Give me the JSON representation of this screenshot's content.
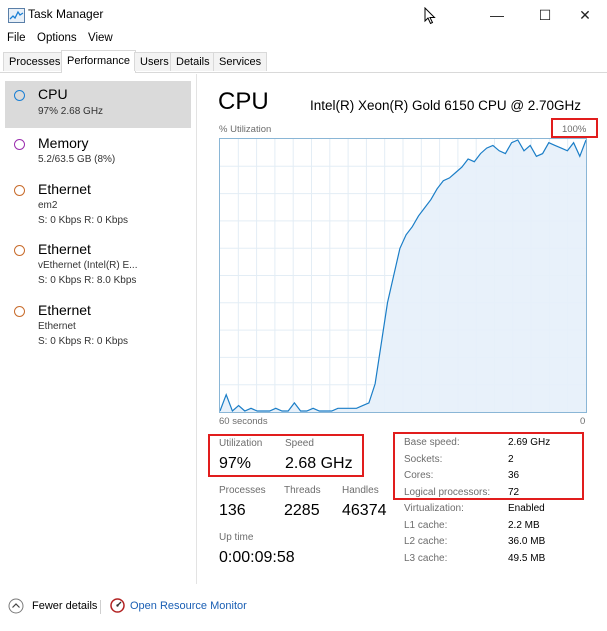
{
  "window": {
    "title": "Task Manager",
    "minimize": "—",
    "maximize": "☐",
    "close": "✕"
  },
  "menu": [
    "File",
    "Options",
    "View"
  ],
  "tabs": [
    "Processes",
    "Performance",
    "Users",
    "Details",
    "Services"
  ],
  "sidebar": [
    {
      "title": "CPU",
      "line1": "97% 2.68 GHz",
      "line2": "",
      "color": "#1a7fd4"
    },
    {
      "title": "Memory",
      "line1": "5.2/63.5 GB (8%)",
      "line2": "",
      "color": "#9b2fae"
    },
    {
      "title": "Ethernet",
      "line1": "em2",
      "line2": "S: 0 Kbps R: 0 Kbps",
      "color": "#c86c2c"
    },
    {
      "title": "Ethernet",
      "line1": "vEthernet (Intel(R) E...",
      "line2": "S: 0 Kbps R: 8.0 Kbps",
      "color": "#c86c2c"
    },
    {
      "title": "Ethernet",
      "line1": "Ethernet",
      "line2": "S: 0 Kbps R: 0 Kbps",
      "color": "#c86c2c"
    }
  ],
  "main": {
    "title": "CPU",
    "model": "Intel(R) Xeon(R) Gold 6150 CPU @ 2.70GHz",
    "util_label": "% Utilization",
    "max_label": "100%",
    "x_left": "60 seconds",
    "x_right": "0"
  },
  "chart_data": {
    "type": "area",
    "x_range": [
      60,
      0
    ],
    "ylim": [
      0,
      100
    ],
    "y": [
      0,
      6,
      0,
      2,
      0,
      1,
      0,
      0,
      0,
      1,
      0,
      0,
      3,
      0,
      0,
      1,
      0,
      0,
      0,
      1,
      1,
      1,
      1,
      2,
      3,
      10,
      25,
      40,
      50,
      60,
      65,
      68,
      72,
      75,
      78,
      82,
      85,
      86,
      88,
      90,
      93,
      92,
      95,
      97,
      98,
      96,
      95,
      99,
      100,
      96,
      98,
      94,
      95,
      99,
      98,
      97,
      96,
      99,
      94,
      100
    ]
  },
  "stats": {
    "utilization_label": "Utilization",
    "utilization": "97%",
    "speed_label": "Speed",
    "speed": "2.68 GHz",
    "processes_label": "Processes",
    "processes": "136",
    "threads_label": "Threads",
    "threads": "2285",
    "handles_label": "Handles",
    "handles": "46374",
    "uptime_label": "Up time",
    "uptime": "0:00:09:58"
  },
  "specs": [
    {
      "label": "Base speed:",
      "value": "2.69 GHz"
    },
    {
      "label": "Sockets:",
      "value": "2"
    },
    {
      "label": "Cores:",
      "value": "36"
    },
    {
      "label": "Logical processors:",
      "value": "72"
    },
    {
      "label": "Virtualization:",
      "value": "Enabled"
    },
    {
      "label": "L1 cache:",
      "value": "2.2 MB"
    },
    {
      "label": "L2 cache:",
      "value": "36.0 MB"
    },
    {
      "label": "L3 cache:",
      "value": "49.5 MB"
    }
  ],
  "footer": {
    "fewer": "Fewer details",
    "monitor": "Open Resource Monitor"
  }
}
